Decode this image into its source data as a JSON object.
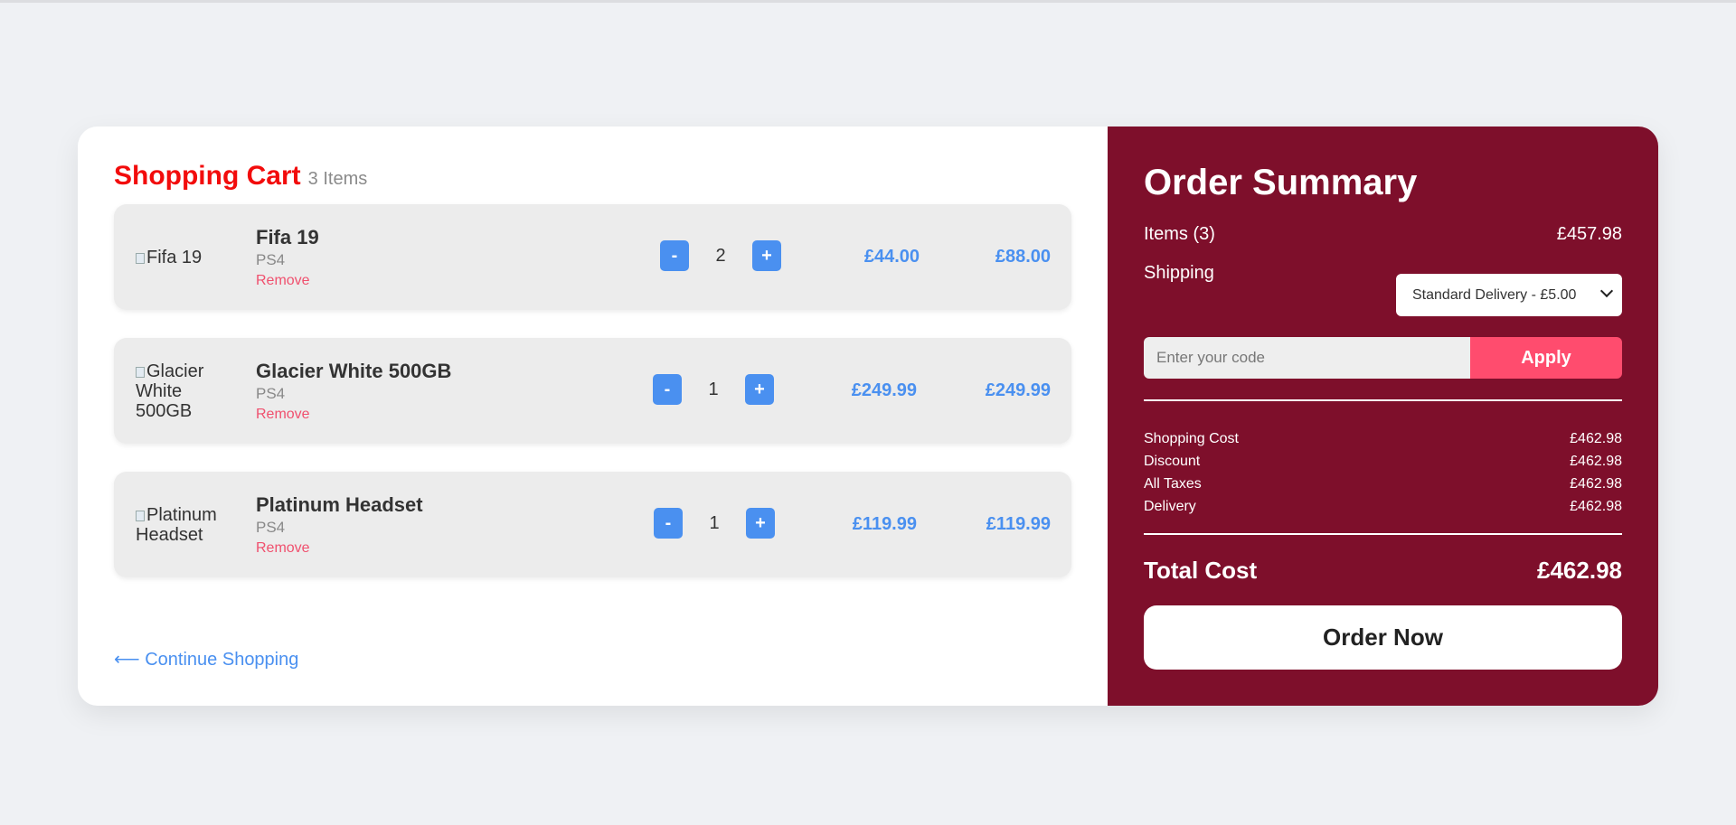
{
  "cart": {
    "title": "Shopping Cart",
    "count": "3 Items",
    "items": [
      {
        "image_alt": "Fifa 19",
        "name": "Fifa 19",
        "platform": "PS4",
        "remove": "Remove",
        "minus": "-",
        "qty": "2",
        "plus": "+",
        "price": "£44.00",
        "total": "£88.00"
      },
      {
        "image_alt": "Glacier White 500GB",
        "name": "Glacier White 500GB",
        "platform": "PS4",
        "remove": "Remove",
        "minus": "-",
        "qty": "1",
        "plus": "+",
        "price": "£249.99",
        "total": "£249.99"
      },
      {
        "image_alt": "Platinum Headset",
        "name": "Platinum Headset",
        "platform": "PS4",
        "remove": "Remove",
        "minus": "-",
        "qty": "1",
        "plus": "+",
        "price": "£119.99",
        "total": "£119.99"
      }
    ],
    "continue_label": "Continue Shopping",
    "continue_arrow": "⟵"
  },
  "summary": {
    "title": "Order Summary",
    "items_label": "Items (3)",
    "items_value": "£457.98",
    "shipping_label": "Shipping",
    "shipping_selected": "Standard Delivery - £5.00",
    "promo_placeholder": "Enter your code",
    "apply_label": "Apply",
    "costs": [
      {
        "label": "Shopping Cost",
        "value": "£462.98"
      },
      {
        "label": "Discount",
        "value": "£462.98"
      },
      {
        "label": "All Taxes",
        "value": "£462.98"
      },
      {
        "label": "Delivery",
        "value": "£462.98"
      }
    ],
    "total_label": "Total Cost",
    "total_value": "£462.98",
    "order_label": "Order Now"
  },
  "colors": {
    "accent_blue": "#4a90f0",
    "cart_title_red": "#f20c0c",
    "summary_bg": "#7e0f2b",
    "apply_pink": "#ff4c6e"
  }
}
